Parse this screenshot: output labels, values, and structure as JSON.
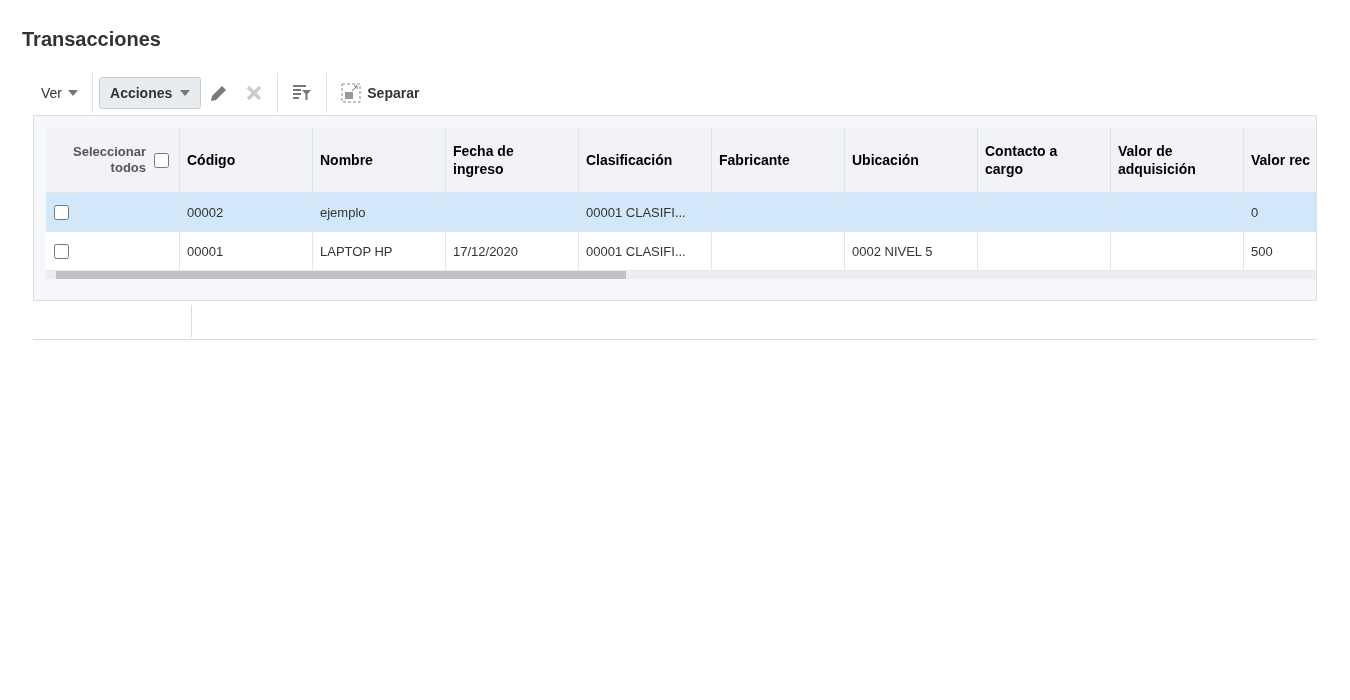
{
  "title": "Transacciones",
  "toolbar": {
    "view_menu": "Ver",
    "actions_menu": "Acciones",
    "edit_disabled": false,
    "delete_disabled": true,
    "detach": "Separar"
  },
  "table": {
    "select_all": {
      "label": "Seleccionar todos",
      "checked": false
    },
    "columns": [
      "Código",
      "Nombre",
      "Fecha de ingreso",
      "Clasificación",
      "Fabricante",
      "Ubicación",
      "Contacto a cargo",
      "Valor de adquisición",
      "Valor rec"
    ],
    "rows": [
      {
        "selected": true,
        "checked": false,
        "cells": [
          "00002",
          "ejemplo",
          "",
          "00001 CLASIFI...",
          "",
          "",
          "",
          "",
          "0"
        ]
      },
      {
        "selected": false,
        "checked": false,
        "cells": [
          "00001",
          "LAPTOP HP",
          "17/12/2020",
          "00001 CLASIFI...",
          "",
          "0002 NIVEL 5",
          "",
          "",
          "500"
        ]
      }
    ]
  }
}
